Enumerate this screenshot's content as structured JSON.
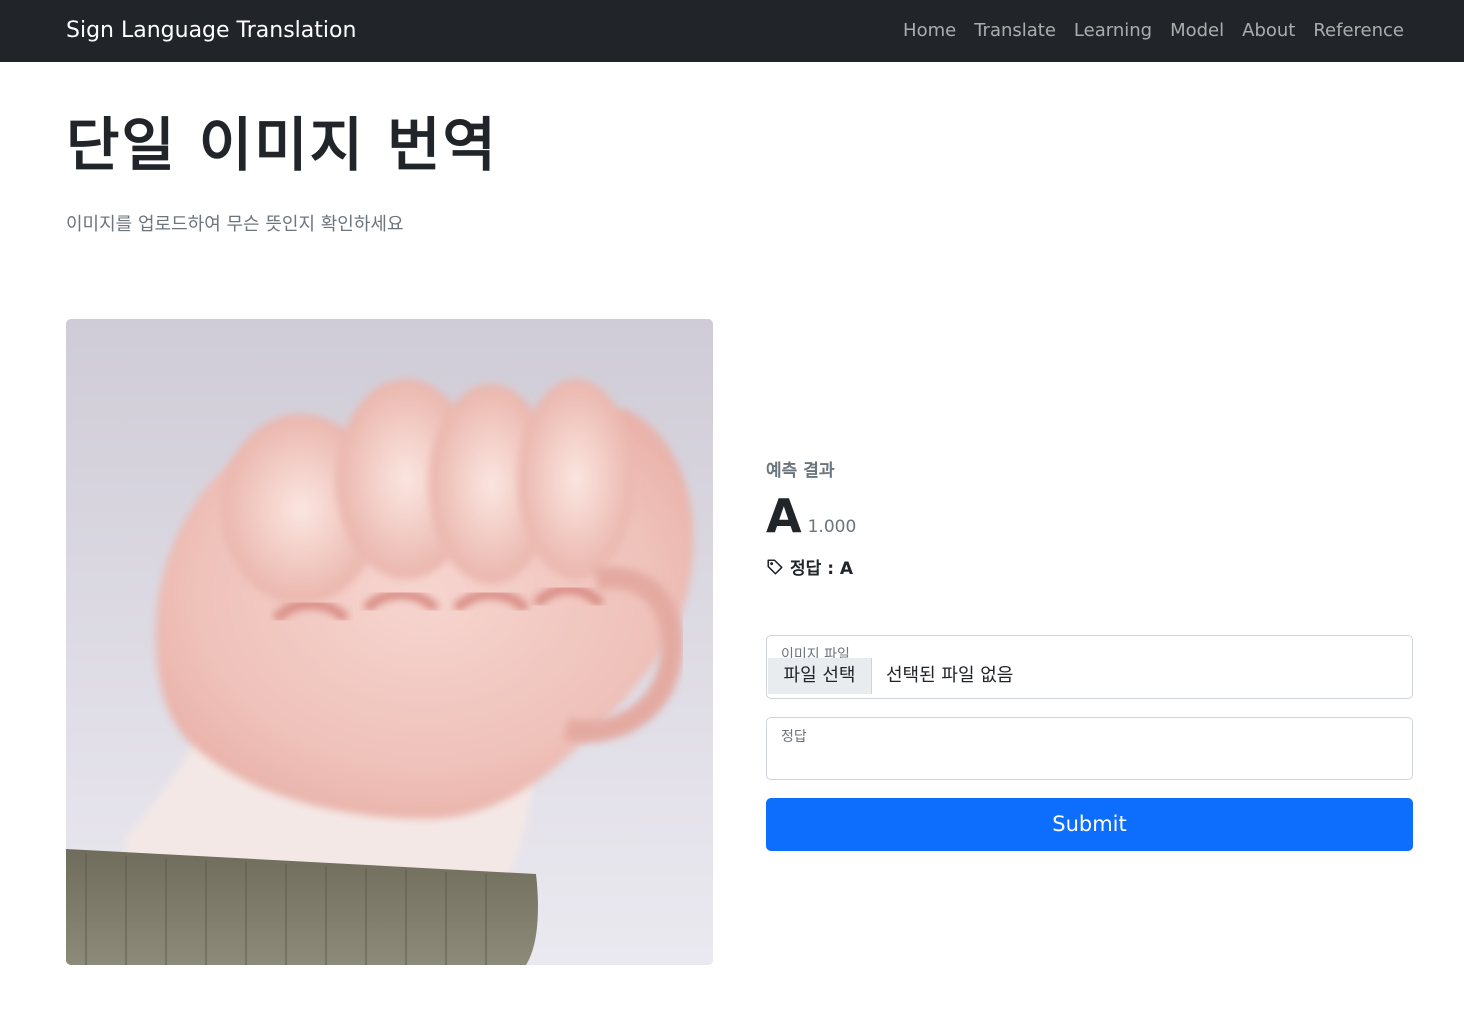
{
  "navbar": {
    "brand": "Sign Language Translation",
    "links": [
      "Home",
      "Translate",
      "Learning",
      "Model",
      "About",
      "Reference"
    ]
  },
  "header": {
    "title": "단일 이미지 번역",
    "subtitle": "이미지를 업로드하여 무슨 뜻인지 확인하세요"
  },
  "image": {
    "subject": "hand-fist-sign-a-photo"
  },
  "result": {
    "label": "예측 결과",
    "letter": "A",
    "score": "1.000",
    "answer": "정답 : A",
    "answer_icon": "tag-icon"
  },
  "form": {
    "file_label": "이미지 파일",
    "file_button": "파일 선택",
    "file_status": "선택된 파일 없음",
    "answer_label": "정답",
    "answer_value": "",
    "submit_label": "Submit"
  },
  "colors": {
    "navbar_bg": "#212529",
    "primary": "#0d6efd",
    "muted": "#6c757d"
  }
}
